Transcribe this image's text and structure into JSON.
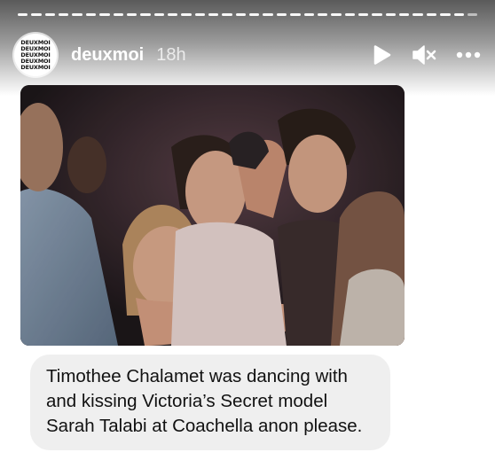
{
  "story": {
    "segments": 34,
    "segments_done": 33
  },
  "header": {
    "avatar_text": [
      "DEUXMOI",
      "DEUXMOI",
      "DEUXMOI",
      "DEUXMOI",
      "DEUXMOI"
    ],
    "username": "deuxmoi",
    "time": "18h",
    "icons": [
      "play-icon",
      "mute-icon",
      "more-icon"
    ]
  },
  "post": {
    "image_alt": "group of people dancing at a night party",
    "caption_lines": [
      "Timothee Chalamet was dancing with",
      "and kissing Victoria’s Secret model",
      "Sarah Talabi at Coachella anon please."
    ]
  },
  "colors": {
    "caption_bg": "#efefef",
    "header_text": "#ffffff"
  }
}
